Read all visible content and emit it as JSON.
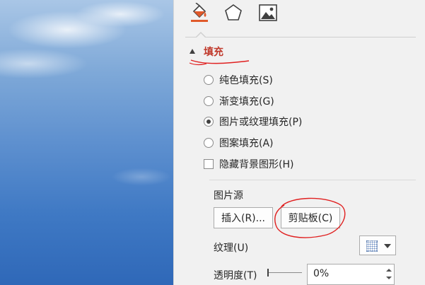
{
  "tabs": [
    {
      "icon": "paint-bucket-icon",
      "active": true
    },
    {
      "icon": "pentagon-shape-icon",
      "active": false
    },
    {
      "icon": "picture-icon",
      "active": false
    }
  ],
  "colors": {
    "accent": "#c0392b",
    "annotation": "#e02020",
    "fill_tab_orange": "#e05a2b"
  },
  "fill_section": {
    "title": "填充",
    "expanded": true,
    "options": [
      {
        "label": "纯色填充(S)",
        "selected": false
      },
      {
        "label": "渐变填充(G)",
        "selected": false
      },
      {
        "label": "图片或纹理填充(P)",
        "selected": true
      },
      {
        "label": "图案填充(A)",
        "selected": false
      }
    ],
    "hide_background": {
      "label": "隐藏背景图形(H)",
      "checked": false
    }
  },
  "picture_source": {
    "label": "图片源",
    "insert_button": "插入(R)...",
    "clipboard_button": "剪贴板(C)"
  },
  "texture": {
    "label": "纹理(U)"
  },
  "transparency": {
    "label": "透明度(T)",
    "value": "0%"
  }
}
